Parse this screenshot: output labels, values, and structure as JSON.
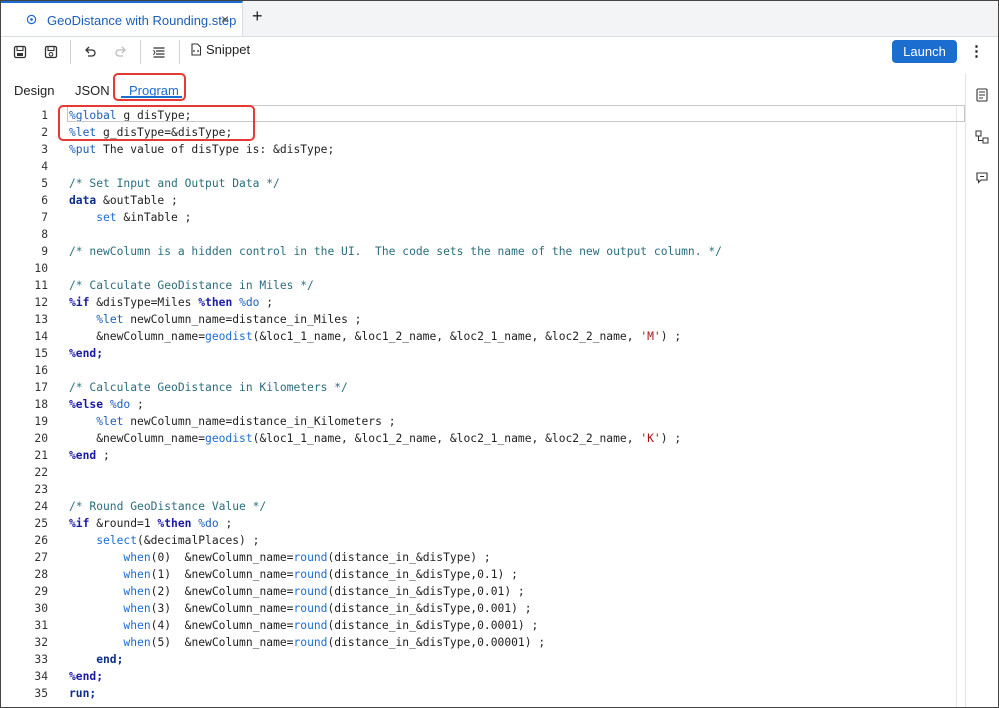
{
  "file_tab": {
    "title": "GeoDistance with Rounding.step",
    "close": "×",
    "new_tab": "+"
  },
  "toolbar": {
    "snippet_label": "Snippet",
    "launch_label": "Launch",
    "more": "⋮"
  },
  "view_tabs": [
    {
      "label": "Design",
      "active": false
    },
    {
      "label": "JSON",
      "active": false
    },
    {
      "label": "Program",
      "active": true
    }
  ],
  "colors": {
    "accent": "#1c6dd0",
    "highlight": "#e53935"
  },
  "editor": {
    "lines": [
      {
        "n": "1",
        "tokens": [
          [
            "%global",
            "c-macro"
          ],
          [
            " g_disType;",
            "c-txt"
          ]
        ]
      },
      {
        "n": "2",
        "tokens": [
          [
            "%let",
            "c-macro"
          ],
          [
            " g_disType=&disType;",
            "c-txt"
          ]
        ]
      },
      {
        "n": "3",
        "tokens": [
          [
            "%put",
            "c-macro"
          ],
          [
            " The value of disType is: &disType;",
            "c-txt"
          ]
        ]
      },
      {
        "n": "4",
        "tokens": []
      },
      {
        "n": "5",
        "tokens": [
          [
            "/* Set Input and Output Data */",
            "c-comment"
          ]
        ]
      },
      {
        "n": "6",
        "tokens": [
          [
            "data",
            "c-kwd"
          ],
          [
            " &outTable ;",
            "c-txt"
          ]
        ]
      },
      {
        "n": "7",
        "tokens": [
          [
            "    set",
            "c-dd"
          ],
          [
            " &inTable ;",
            "c-txt"
          ]
        ]
      },
      {
        "n": "8",
        "tokens": []
      },
      {
        "n": "9",
        "tokens": [
          [
            "/* newColumn is a hidden control in the UI.  The code sets the name of the new output column. */",
            "c-comment"
          ]
        ]
      },
      {
        "n": "10",
        "tokens": []
      },
      {
        "n": "11",
        "tokens": [
          [
            "/* Calculate GeoDistance in Miles */",
            "c-comment"
          ]
        ]
      },
      {
        "n": "12",
        "tokens": [
          [
            "%if",
            "c-key"
          ],
          [
            " &disType=Miles ",
            "c-txt"
          ],
          [
            "%then",
            "c-key"
          ],
          [
            " ",
            "c-txt"
          ],
          [
            "%do",
            "c-macro"
          ],
          [
            " ;",
            "c-txt"
          ]
        ]
      },
      {
        "n": "13",
        "tokens": [
          [
            "    ",
            "c-txt"
          ],
          [
            "%let",
            "c-macro"
          ],
          [
            " newColumn_name=distance_in_Miles ;",
            "c-txt"
          ]
        ]
      },
      {
        "n": "14",
        "tokens": [
          [
            "    &newColumn_name=",
            "c-txt"
          ],
          [
            "geodist",
            "c-func"
          ],
          [
            "(&loc1_1_name, &loc1_2_name, &loc2_1_name, &loc2_2_name, ",
            "c-txt"
          ],
          [
            "'M'",
            "c-str"
          ],
          [
            ") ;",
            "c-txt"
          ]
        ]
      },
      {
        "n": "15",
        "tokens": [
          [
            "%end;",
            "c-key"
          ]
        ]
      },
      {
        "n": "16",
        "tokens": []
      },
      {
        "n": "17",
        "tokens": [
          [
            "/* Calculate GeoDistance in Kilometers */",
            "c-comment"
          ]
        ]
      },
      {
        "n": "18",
        "tokens": [
          [
            "%else",
            "c-key"
          ],
          [
            " ",
            "c-txt"
          ],
          [
            "%do",
            "c-macro"
          ],
          [
            " ;",
            "c-txt"
          ]
        ]
      },
      {
        "n": "19",
        "tokens": [
          [
            "    ",
            "c-txt"
          ],
          [
            "%let",
            "c-macro"
          ],
          [
            " newColumn_name=distance_in_Kilometers ;",
            "c-txt"
          ]
        ]
      },
      {
        "n": "20",
        "tokens": [
          [
            "    &newColumn_name=",
            "c-txt"
          ],
          [
            "geodist",
            "c-func"
          ],
          [
            "(&loc1_1_name, &loc1_2_name, &loc2_1_name, &loc2_2_name, ",
            "c-txt"
          ],
          [
            "'K'",
            "c-str"
          ],
          [
            ") ;",
            "c-txt"
          ]
        ]
      },
      {
        "n": "21",
        "tokens": [
          [
            "%end",
            "c-key"
          ],
          [
            " ;",
            "c-txt"
          ]
        ]
      },
      {
        "n": "22",
        "tokens": []
      },
      {
        "n": "23",
        "tokens": []
      },
      {
        "n": "24",
        "tokens": [
          [
            "/* Round GeoDistance Value */",
            "c-comment"
          ]
        ]
      },
      {
        "n": "25",
        "tokens": [
          [
            "%if",
            "c-key"
          ],
          [
            " &round=1 ",
            "c-txt"
          ],
          [
            "%then",
            "c-key"
          ],
          [
            " ",
            "c-txt"
          ],
          [
            "%do",
            "c-macro"
          ],
          [
            " ;",
            "c-txt"
          ]
        ]
      },
      {
        "n": "26",
        "tokens": [
          [
            "    ",
            "c-txt"
          ],
          [
            "select",
            "c-func"
          ],
          [
            "(&decimalPlaces) ;",
            "c-txt"
          ]
        ]
      },
      {
        "n": "27",
        "tokens": [
          [
            "        ",
            "c-txt"
          ],
          [
            "when",
            "c-func"
          ],
          [
            "(0)  &newColumn_name=",
            "c-txt"
          ],
          [
            "round",
            "c-func"
          ],
          [
            "(distance_in_&disType) ;",
            "c-txt"
          ]
        ]
      },
      {
        "n": "28",
        "tokens": [
          [
            "        ",
            "c-txt"
          ],
          [
            "when",
            "c-func"
          ],
          [
            "(1)  &newColumn_name=",
            "c-txt"
          ],
          [
            "round",
            "c-func"
          ],
          [
            "(distance_in_&disType,0.1) ;",
            "c-txt"
          ]
        ]
      },
      {
        "n": "29",
        "tokens": [
          [
            "        ",
            "c-txt"
          ],
          [
            "when",
            "c-func"
          ],
          [
            "(2)  &newColumn_name=",
            "c-txt"
          ],
          [
            "round",
            "c-func"
          ],
          [
            "(distance_in_&disType,0.01) ;",
            "c-txt"
          ]
        ]
      },
      {
        "n": "30",
        "tokens": [
          [
            "        ",
            "c-txt"
          ],
          [
            "when",
            "c-func"
          ],
          [
            "(3)  &newColumn_name=",
            "c-txt"
          ],
          [
            "round",
            "c-func"
          ],
          [
            "(distance_in_&disType,0.001) ;",
            "c-txt"
          ]
        ]
      },
      {
        "n": "31",
        "tokens": [
          [
            "        ",
            "c-txt"
          ],
          [
            "when",
            "c-func"
          ],
          [
            "(4)  &newColumn_name=",
            "c-txt"
          ],
          [
            "round",
            "c-func"
          ],
          [
            "(distance_in_&disType,0.0001) ;",
            "c-txt"
          ]
        ]
      },
      {
        "n": "32",
        "tokens": [
          [
            "        ",
            "c-txt"
          ],
          [
            "when",
            "c-func"
          ],
          [
            "(5)  &newColumn_name=",
            "c-txt"
          ],
          [
            "round",
            "c-func"
          ],
          [
            "(distance_in_&disType,0.00001) ;",
            "c-txt"
          ]
        ]
      },
      {
        "n": "33",
        "tokens": [
          [
            "    end;",
            "c-kwd"
          ]
        ]
      },
      {
        "n": "34",
        "tokens": [
          [
            "%end;",
            "c-key"
          ]
        ]
      },
      {
        "n": "35",
        "tokens": [
          [
            "run;",
            "c-kwd"
          ]
        ]
      }
    ]
  }
}
